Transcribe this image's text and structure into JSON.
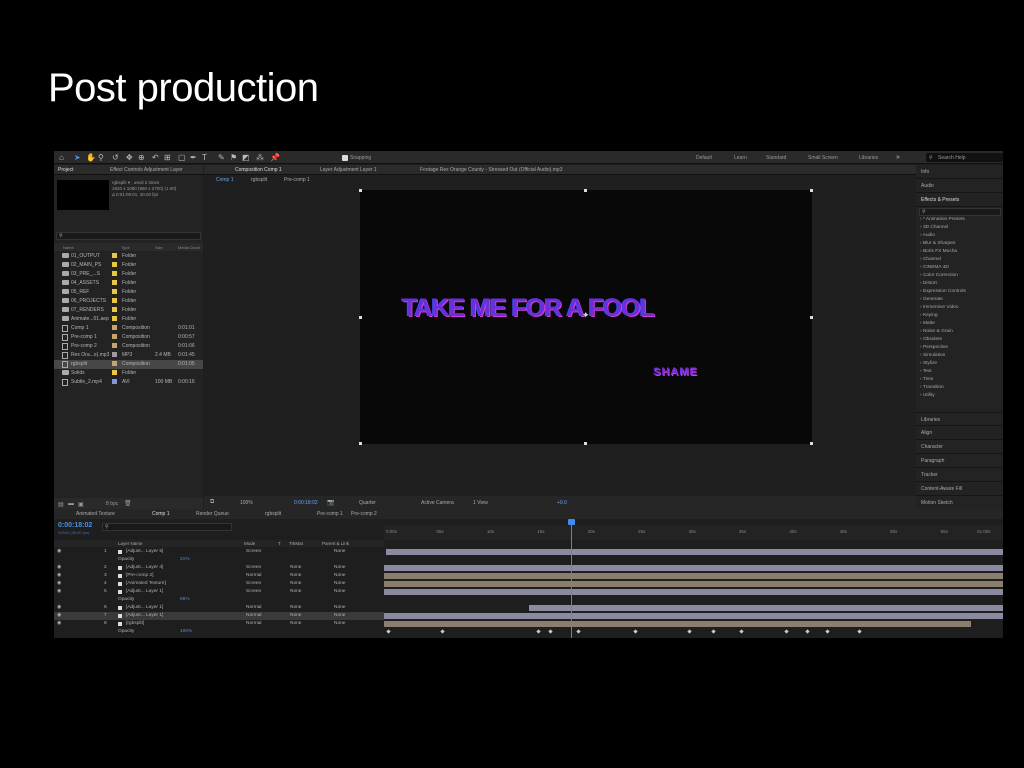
{
  "slide": {
    "title": "Post production"
  },
  "toolbar": {
    "snapping": "Snapping",
    "workspaces": [
      "Default",
      "Learn",
      "Standard",
      "Small Screen",
      "Libraries"
    ],
    "search_placeholder": "Search Help"
  },
  "project_panel": {
    "tabs": [
      "Project",
      "Effect Controls Adjustment Layer"
    ],
    "item_name": "rgbsplit ▾ , used 2 times",
    "item_info1": "1920 x 1080 (960 x 2700) (1.00)",
    "item_info2": "Δ 0:01:05:01, 30.00 fps",
    "columns": [
      "Name",
      "Type",
      "Size",
      "Media Durat"
    ],
    "items": [
      {
        "name": "01_OUTPUT",
        "type": "Folder",
        "size": "",
        "dur": "",
        "kind": "folder",
        "color": "#e8c840"
      },
      {
        "name": "02_MAIN_PS",
        "type": "Folder",
        "size": "",
        "dur": "",
        "kind": "folder",
        "color": "#e8c840"
      },
      {
        "name": "03_PRE_...S",
        "type": "Folder",
        "size": "",
        "dur": "",
        "kind": "folder",
        "color": "#e8c840"
      },
      {
        "name": "04_ASSETS",
        "type": "Folder",
        "size": "",
        "dur": "",
        "kind": "folder",
        "color": "#e8c840"
      },
      {
        "name": "05_REF",
        "type": "Folder",
        "size": "",
        "dur": "",
        "kind": "folder",
        "color": "#e8c840"
      },
      {
        "name": "06_PROJECTS",
        "type": "Folder",
        "size": "",
        "dur": "",
        "kind": "folder",
        "color": "#e8c840"
      },
      {
        "name": "07_RENDERS",
        "type": "Folder",
        "size": "",
        "dur": "",
        "kind": "folder",
        "color": "#e8c840"
      },
      {
        "name": "Animate...01.aep",
        "type": "Folder",
        "size": "",
        "dur": "",
        "kind": "folder",
        "color": "#e8c840"
      },
      {
        "name": "Comp 1",
        "type": "Composition",
        "size": "",
        "dur": "0:01:01",
        "kind": "comp",
        "color": "#c9a46a"
      },
      {
        "name": "Pre-comp 1",
        "type": "Composition",
        "size": "",
        "dur": "0:00:57",
        "kind": "comp",
        "color": "#c9a46a"
      },
      {
        "name": "Pre-comp 2",
        "type": "Composition",
        "size": "",
        "dur": "0:01:06",
        "kind": "comp",
        "color": "#c9a46a"
      },
      {
        "name": "Rex Ora...o).mp3",
        "type": "MP3",
        "size": "2.4 MB",
        "dur": "0:01:45",
        "kind": "file",
        "color": "#9c9c9c"
      },
      {
        "name": "rgbsplit",
        "type": "Composition",
        "size": "",
        "dur": "0:01:05",
        "kind": "comp",
        "color": "#c9a46a"
      },
      {
        "name": "Solids",
        "type": "Folder",
        "size": "",
        "dur": "",
        "kind": "folder",
        "color": "#e8c840"
      },
      {
        "name": "Subtle_2.mp4",
        "type": "AVI",
        "size": "100 MB",
        "dur": "0:00:16",
        "kind": "file",
        "color": "#7f9ad0"
      }
    ],
    "bpc": "8 bpc"
  },
  "comp_panel": {
    "tabs": [
      "Composition Comp 1",
      "Layer Adjustment Layer 1",
      "Footage Rex Orange County - Stressed Out (Official Audio).mp3"
    ],
    "breadcrumbs": [
      "Comp 1",
      "rgbsplit",
      "Pre-comp 1"
    ],
    "main_text": "TAKE ME FOR A FOOL",
    "sub_text": "SHAME",
    "viewer_bar": {
      "zoom": "100%",
      "timecode": "0:00:18:02",
      "resolution": "Quarter",
      "camera": "Active Camera",
      "views": "1 View",
      "exposure": "+0.0"
    }
  },
  "right_panel": {
    "panels_top": [
      "Info",
      "Audio",
      "Effects & Presets"
    ],
    "effects": [
      "* Animation Presets",
      "3D Channel",
      "Audio",
      "Blur & Sharpen",
      "Boris FX Mocha",
      "Channel",
      "CINEMA 4D",
      "Color Correction",
      "Distort",
      "Expression Controls",
      "Generate",
      "Immersive Video",
      "Keying",
      "Matte",
      "Noise & Grain",
      "Obsolete",
      "Perspective",
      "Simulation",
      "Stylize",
      "Text",
      "Time",
      "Transition",
      "Utility"
    ],
    "panels_bottom": [
      "Libraries",
      "Align",
      "Character",
      "Paragraph",
      "Tracker",
      "Content-Aware Fill",
      "Motion Sketch"
    ]
  },
  "timeline": {
    "tabs": [
      "Animated Texture",
      "Comp 1",
      "Render Queue",
      "rgbsplit",
      "Pre-comp 1",
      "Pre-comp 2"
    ],
    "timecode": "0:00:18:02",
    "timecode_sub": "00542 (30.00 fps)",
    "columns": [
      "Layer Name",
      "Mode",
      "T",
      "TrkMat",
      "Parent & Link"
    ],
    "ruler": [
      "0:00s",
      "05s",
      "10s",
      "15s",
      "20s",
      "25s",
      "30s",
      "35s",
      "40s",
      "45s",
      "50s",
      "55s",
      "01:00s"
    ],
    "rows": [
      {
        "num": "1",
        "name": "[Adjust... Layer 5]",
        "mode": "Screen",
        "trkmat": "",
        "parent": "None"
      },
      {
        "num": "",
        "name": "Opacity",
        "mode": "21%",
        "trkmat": "",
        "parent": ""
      },
      {
        "num": "2",
        "name": "[Adjust... Layer 4]",
        "mode": "Screen",
        "trkmat": "None",
        "parent": "None"
      },
      {
        "num": "3",
        "name": "[Pre-comp 2]",
        "mode": "Normal",
        "trkmat": "None",
        "parent": "None"
      },
      {
        "num": "4",
        "name": "[Animated Texture]",
        "mode": "Screen",
        "trkmat": "None",
        "parent": "None"
      },
      {
        "num": "5",
        "name": "[Adjust... Layer 1]",
        "mode": "Screen",
        "trkmat": "None",
        "parent": "None"
      },
      {
        "num": "",
        "name": "Opacity",
        "mode": "86%",
        "trkmat": "",
        "parent": ""
      },
      {
        "num": "6",
        "name": "[Adjust... Layer 1]",
        "mode": "Normal",
        "trkmat": "None",
        "parent": "None"
      },
      {
        "num": "7",
        "name": "[Adjust... Layer 1]",
        "mode": "Normal",
        "trkmat": "None",
        "parent": "None"
      },
      {
        "num": "8",
        "name": "[rgbsplit]",
        "mode": "Normal",
        "trkmat": "None",
        "parent": "None"
      },
      {
        "num": "",
        "name": "Opacity",
        "mode": "100%",
        "trkmat": "",
        "parent": ""
      }
    ]
  }
}
